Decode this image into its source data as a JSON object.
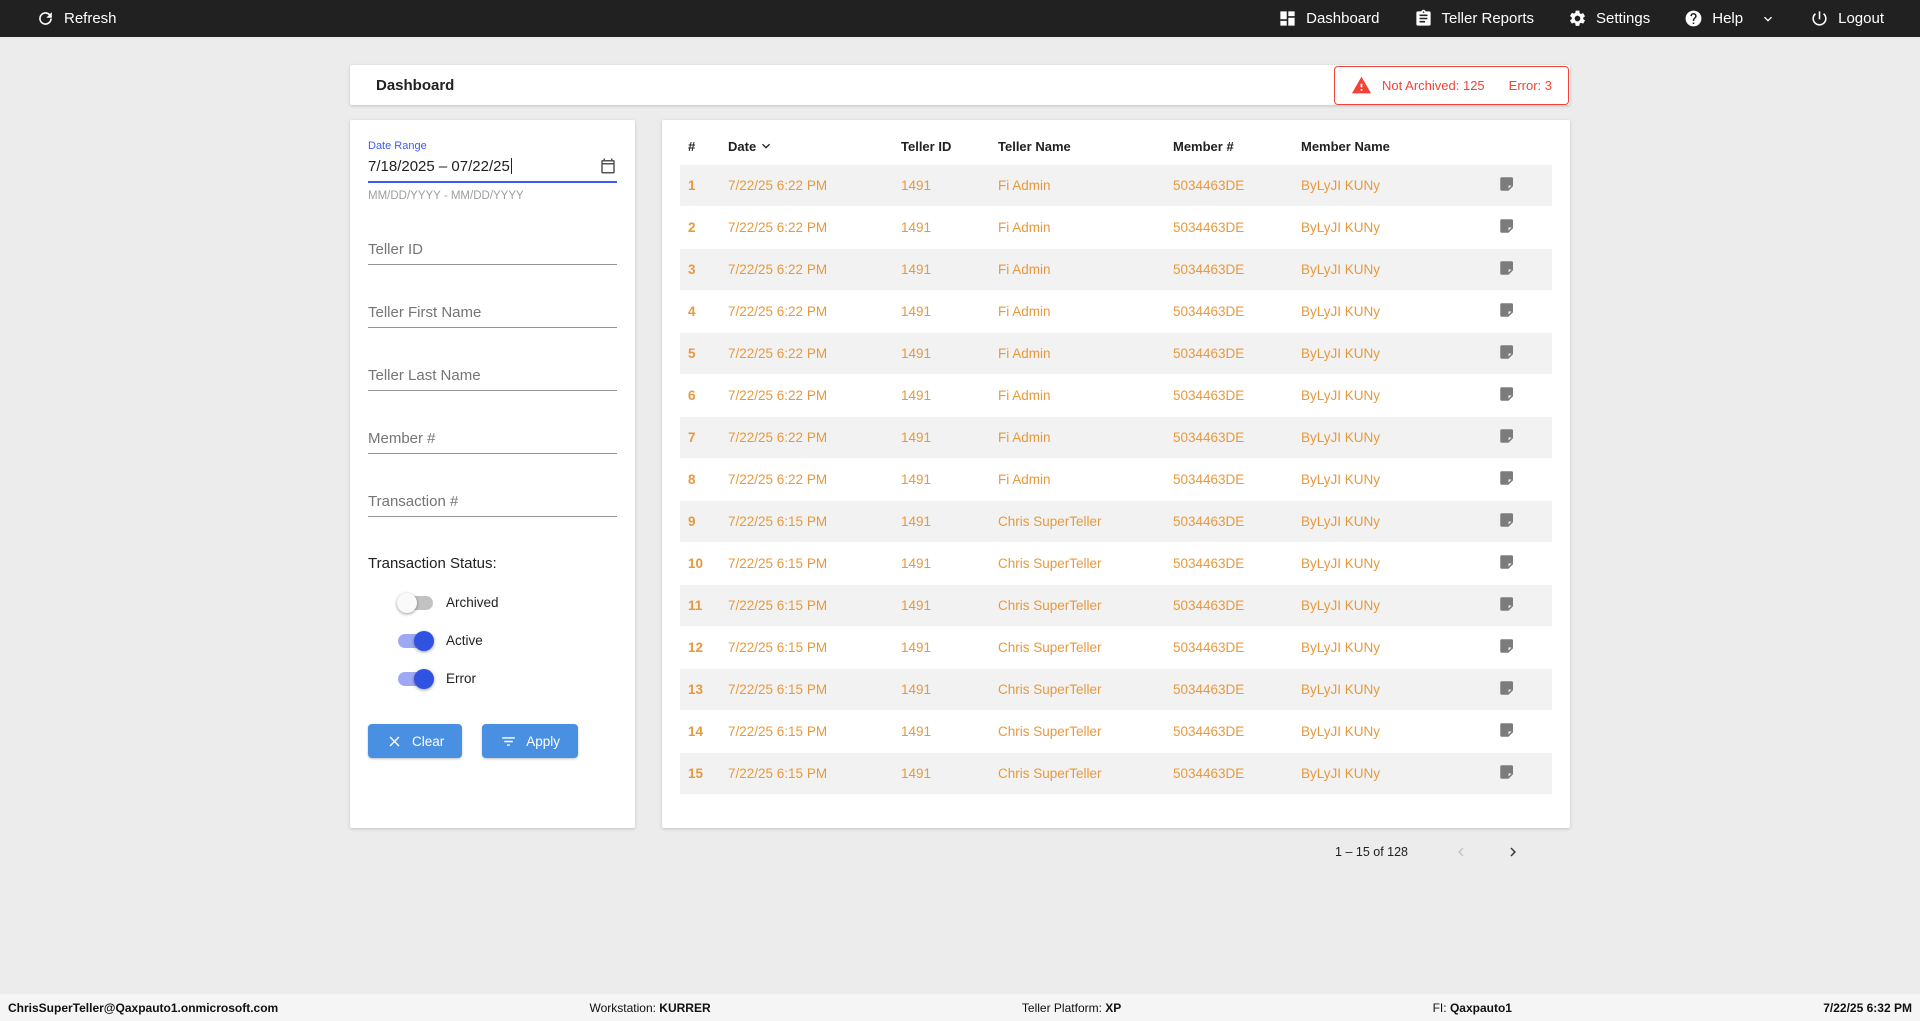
{
  "colors": {
    "topbar_bg": "#212121",
    "accent_orange": "#e8993c",
    "button_blue": "#4a90e2",
    "toggle_blue": "#2f52e0",
    "alert_red": "#f44336"
  },
  "topbar": {
    "refresh_label": "Refresh",
    "nav": [
      {
        "label": "Dashboard"
      },
      {
        "label": "Teller Reports"
      },
      {
        "label": "Settings"
      },
      {
        "label": "Help"
      },
      {
        "label": "Logout"
      }
    ]
  },
  "header": {
    "title": "Dashboard",
    "alert": {
      "not_archived": "Not Archived: 125",
      "error": "Error: 3"
    }
  },
  "filters": {
    "date_range": {
      "label": "Date Range",
      "value": "7/18/2025 – 07/22/25",
      "hint": "MM/DD/YYYY - MM/DD/YYYY"
    },
    "fields": [
      {
        "placeholder": "Teller ID"
      },
      {
        "placeholder": "Teller First Name"
      },
      {
        "placeholder": "Teller Last Name"
      },
      {
        "placeholder": "Member #"
      },
      {
        "placeholder": "Transaction #"
      }
    ],
    "status_label": "Transaction Status:",
    "toggles": [
      {
        "label": "Archived",
        "on": false
      },
      {
        "label": "Active",
        "on": true
      },
      {
        "label": "Error",
        "on": true
      }
    ],
    "clear_label": "Clear",
    "apply_label": "Apply"
  },
  "table": {
    "columns": [
      "#",
      "Date",
      "Teller ID",
      "Teller Name",
      "Member #",
      "Member Name"
    ],
    "sorted_by": "Date",
    "sort_direction": "desc",
    "rows": [
      {
        "num": "1",
        "date": "7/22/25 6:22 PM",
        "teller_id": "1491",
        "teller_name": "Fi Admin",
        "member_num": "5034463DE",
        "member_name": "ByLyJI KUNy"
      },
      {
        "num": "2",
        "date": "7/22/25 6:22 PM",
        "teller_id": "1491",
        "teller_name": "Fi Admin",
        "member_num": "5034463DE",
        "member_name": "ByLyJI KUNy"
      },
      {
        "num": "3",
        "date": "7/22/25 6:22 PM",
        "teller_id": "1491",
        "teller_name": "Fi Admin",
        "member_num": "5034463DE",
        "member_name": "ByLyJI KUNy"
      },
      {
        "num": "4",
        "date": "7/22/25 6:22 PM",
        "teller_id": "1491",
        "teller_name": "Fi Admin",
        "member_num": "5034463DE",
        "member_name": "ByLyJI KUNy"
      },
      {
        "num": "5",
        "date": "7/22/25 6:22 PM",
        "teller_id": "1491",
        "teller_name": "Fi Admin",
        "member_num": "5034463DE",
        "member_name": "ByLyJI KUNy"
      },
      {
        "num": "6",
        "date": "7/22/25 6:22 PM",
        "teller_id": "1491",
        "teller_name": "Fi Admin",
        "member_num": "5034463DE",
        "member_name": "ByLyJI KUNy"
      },
      {
        "num": "7",
        "date": "7/22/25 6:22 PM",
        "teller_id": "1491",
        "teller_name": "Fi Admin",
        "member_num": "5034463DE",
        "member_name": "ByLyJI KUNy"
      },
      {
        "num": "8",
        "date": "7/22/25 6:22 PM",
        "teller_id": "1491",
        "teller_name": "Fi Admin",
        "member_num": "5034463DE",
        "member_name": "ByLyJI KUNy"
      },
      {
        "num": "9",
        "date": "7/22/25 6:15 PM",
        "teller_id": "1491",
        "teller_name": "Chris SuperTeller",
        "member_num": "5034463DE",
        "member_name": "ByLyJI KUNy"
      },
      {
        "num": "10",
        "date": "7/22/25 6:15 PM",
        "teller_id": "1491",
        "teller_name": "Chris SuperTeller",
        "member_num": "5034463DE",
        "member_name": "ByLyJI KUNy"
      },
      {
        "num": "11",
        "date": "7/22/25 6:15 PM",
        "teller_id": "1491",
        "teller_name": "Chris SuperTeller",
        "member_num": "5034463DE",
        "member_name": "ByLyJI KUNy"
      },
      {
        "num": "12",
        "date": "7/22/25 6:15 PM",
        "teller_id": "1491",
        "teller_name": "Chris SuperTeller",
        "member_num": "5034463DE",
        "member_name": "ByLyJI KUNy"
      },
      {
        "num": "13",
        "date": "7/22/25 6:15 PM",
        "teller_id": "1491",
        "teller_name": "Chris SuperTeller",
        "member_num": "5034463DE",
        "member_name": "ByLyJI KUNy"
      },
      {
        "num": "14",
        "date": "7/22/25 6:15 PM",
        "teller_id": "1491",
        "teller_name": "Chris SuperTeller",
        "member_num": "5034463DE",
        "member_name": "ByLyJI KUNy"
      },
      {
        "num": "15",
        "date": "7/22/25 6:15 PM",
        "teller_id": "1491",
        "teller_name": "Chris SuperTeller",
        "member_num": "5034463DE",
        "member_name": "ByLyJI KUNy"
      }
    ],
    "pagination": {
      "range": "1 – 15 of 128"
    }
  },
  "statusbar": {
    "user": "ChrisSuperTeller@Qaxpauto1.onmicrosoft.com",
    "workstation_label": "Workstation:",
    "workstation": "KURRER",
    "platform_label": "Teller Platform:",
    "platform": "XP",
    "fi_label": "FI:",
    "fi": "Qaxpauto1",
    "time": "7/22/25 6:32 PM"
  }
}
